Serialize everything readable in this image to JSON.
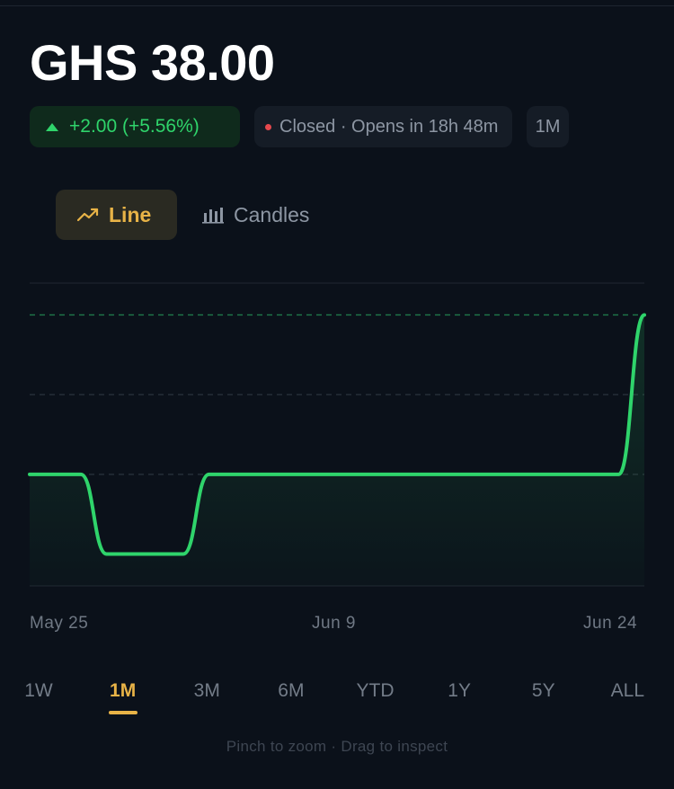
{
  "quote": {
    "price": "GHS 38.00",
    "change": "+2.00 (+5.56%)",
    "status": "Closed · Opens in 18h 48m",
    "range_badge": "1M"
  },
  "modes": {
    "line": "Line",
    "candles": "Candles",
    "active": "line"
  },
  "colors": {
    "background": "#0b111a",
    "accent": "#e8b347",
    "positive": "#2fd46b",
    "closed_dot": "#e5484d"
  },
  "chart_data": {
    "type": "line",
    "x_labels": [
      "May 25",
      "Jun 9",
      "Jun 24"
    ],
    "series": [
      {
        "values": [
          36,
          36,
          36,
          35,
          35,
          35,
          35,
          36,
          36,
          36,
          36,
          36,
          36,
          36,
          36,
          36,
          36,
          36,
          36,
          36,
          36,
          36,
          36,
          36,
          38
        ]
      }
    ],
    "ylim": [
      34.6,
      38.4
    ],
    "reference_line": 38,
    "grid": true
  },
  "time_ranges": {
    "items": [
      "1W",
      "1M",
      "3M",
      "6M",
      "YTD",
      "1Y",
      "5Y",
      "ALL"
    ],
    "active": "1M"
  },
  "hint": "Pinch to zoom · Drag to inspect"
}
